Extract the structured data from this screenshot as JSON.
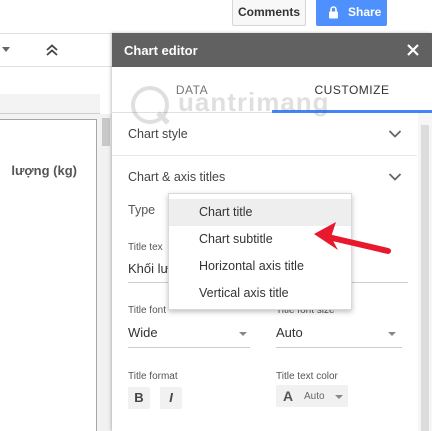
{
  "header": {
    "comments_label": "Comments",
    "share_label": "Share"
  },
  "sheet": {
    "column_text": "lượng (kg)"
  },
  "editor": {
    "title": "Chart editor",
    "tabs": [
      {
        "label": "DATA"
      },
      {
        "label": "CUSTOMIZE"
      }
    ],
    "watermark_text": "uantrimang",
    "sections": [
      {
        "label": "Chart style"
      },
      {
        "label": "Chart & axis titles"
      }
    ],
    "type_label": "Type",
    "title_text_label": "Title tex",
    "title_text_value": "Khối lư",
    "title_font_label": "Title font",
    "title_font_value": "Wide",
    "title_font_size_label": "Title font size",
    "title_font_size_value": "Auto",
    "title_format_label": "Title format",
    "bold_label": "B",
    "italic_label": "I",
    "title_text_color_label": "Title text color",
    "text_color_glyph": "A",
    "text_color_value": "Auto"
  },
  "menu": {
    "items": [
      {
        "label": "Chart title"
      },
      {
        "label": "Chart subtitle"
      },
      {
        "label": "Horizontal axis title"
      },
      {
        "label": "Vertical axis title"
      }
    ],
    "highlighted_index": 0
  },
  "colors": {
    "share_blue": "#4d90fe",
    "header_gray": "#616161",
    "tab_indicator": "#4285f4",
    "annotation_arrow": "#e8192c"
  }
}
